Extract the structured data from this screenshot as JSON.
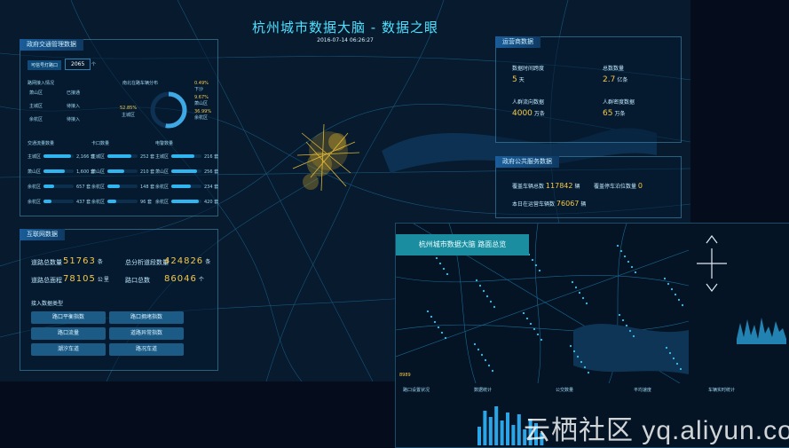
{
  "header": {
    "title": "杭州城市数据大脑 - 数据之眼",
    "datetime": "2016-07-14 06:26:27"
  },
  "traffic_panel": {
    "title": "政府交通管理数据",
    "section_label": "可信号灯路口",
    "section_value": "2065",
    "section_unit": "个",
    "road_label": "路网接入情况",
    "road_rows": [
      {
        "left": "萧山区",
        "right": "已接通"
      },
      {
        "left": "主城区",
        "right": "待接入"
      },
      {
        "left": "余杭区",
        "right": "待接入"
      }
    ],
    "pie_title": "南北在路车辆分布",
    "pie_left": {
      "pct": "52.85%",
      "label": "主城区"
    },
    "pie_right": [
      {
        "pct": "0.49%",
        "label": "下沙"
      },
      {
        "pct": "9.67%",
        "label": "萧山区"
      },
      {
        "pct": "36.99%",
        "label": "余杭区"
      }
    ],
    "pie_share": 0.5285,
    "col_titles": [
      "交通流量数量",
      "卡口数量",
      "电警数量"
    ],
    "col_rows": [
      [
        {
          "label": "主城区",
          "value": "2,166 套",
          "fill": 0.9
        },
        {
          "label": "主城区",
          "value": "252 套",
          "fill": 0.8
        },
        {
          "label": "主城区",
          "value": "216 套",
          "fill": 0.75
        }
      ],
      [
        {
          "label": "萧山区",
          "value": "1,600 套",
          "fill": 0.7
        },
        {
          "label": "萧山区",
          "value": "210 套",
          "fill": 0.55
        },
        {
          "label": "萧山区",
          "value": "256 套",
          "fill": 0.85
        }
      ],
      [
        {
          "label": "余杭区",
          "value": "657 套",
          "fill": 0.35
        },
        {
          "label": "余杭区",
          "value": "148 套",
          "fill": 0.4
        },
        {
          "label": "余杭区",
          "value": "234 套",
          "fill": 0.65
        }
      ],
      [
        {
          "label": "余杭区",
          "value": "437 套",
          "fill": 0.25
        },
        {
          "label": "余杭区",
          "value": "96 套",
          "fill": 0.3
        },
        {
          "label": "余杭区",
          "value": "420 套",
          "fill": 0.9
        }
      ]
    ]
  },
  "internet_panel": {
    "title": "互联网数据",
    "stats": [
      {
        "label": "道路总数量",
        "value": "51763",
        "unit": "条"
      },
      {
        "label": "总分析道段数量",
        "value": "424826",
        "unit": "条"
      },
      {
        "label": "道路总面程",
        "value": "78105",
        "unit": "公里"
      },
      {
        "label": "路口总数",
        "value": "86046",
        "unit": "个"
      }
    ],
    "types_title": "接入数据类型",
    "buttons": [
      "路口平衡指数",
      "路口拥堵指数",
      "路口流量",
      "道路异常指数",
      "潮汐车道",
      "路况车道"
    ]
  },
  "operator_panel": {
    "title": "运营商数据",
    "stats": [
      {
        "label": "数据时间跨度",
        "value": "5",
        "unit": "天"
      },
      {
        "label": "总数数量",
        "value": "2.7",
        "unit": "亿条"
      },
      {
        "label": "人群流向数据",
        "value": "4000",
        "unit": "万条"
      },
      {
        "label": "人群密度数据",
        "value": "65",
        "unit": "万条"
      }
    ]
  },
  "public_panel": {
    "title": "政府公共服务数据",
    "items": [
      {
        "label": "覆盖车辆总数",
        "value": "117842",
        "unit": "辆"
      },
      {
        "label": "覆盖停车泊位数量",
        "value": "0",
        "unit": ""
      },
      {
        "label": "本日在运营车辆数",
        "value": "76067",
        "unit": "辆"
      }
    ]
  },
  "inset": {
    "title": "杭州城市数据大脑 路面总览",
    "bottom_headers": [
      "路口设置状况",
      "数据统计",
      "公交数量",
      "平均速度",
      "车辆实时统计"
    ],
    "chart_heights": [
      0.45,
      0.85,
      0.7,
      0.95,
      0.6,
      0.8,
      0.5,
      0.75,
      0.4,
      0.65,
      0.55,
      0.3
    ],
    "left_count": "8989"
  },
  "watermark": "云栖社区 yq.aliyun.com",
  "colors": {
    "accent": "#4fe0ff",
    "value": "#f5c84a",
    "panel_title": "#1a5d9a",
    "inset_title": "#1b8da0"
  }
}
